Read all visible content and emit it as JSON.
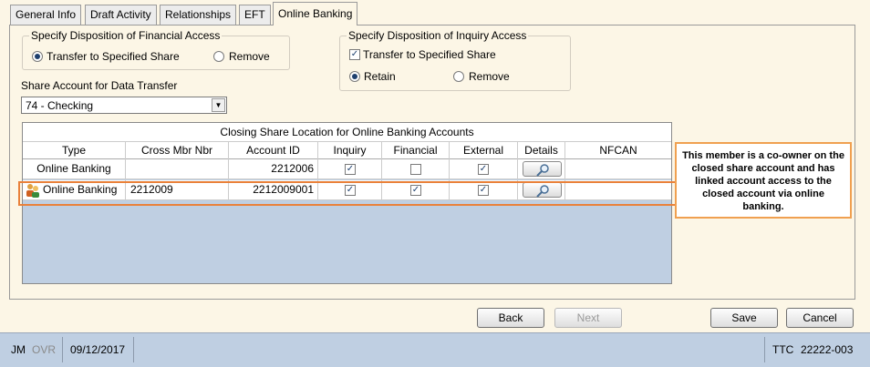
{
  "tabs": [
    "General Info",
    "Draft Activity",
    "Relationships",
    "EFT",
    "Online Banking"
  ],
  "active_tab": "Online Banking",
  "financial_access": {
    "title": "Specify Disposition of Financial Access",
    "options": [
      "Transfer to Specified Share",
      "Remove"
    ],
    "selected": "Transfer to Specified Share"
  },
  "inquiry_access": {
    "title": "Specify Disposition of Inquiry Access",
    "transfer_label": "Transfer to Specified Share",
    "transfer_checked": true,
    "options": [
      "Retain",
      "Remove"
    ],
    "selected": "Retain"
  },
  "share_account": {
    "label": "Share Account for Data Transfer",
    "value": "74 - Checking"
  },
  "grid": {
    "title": "Closing Share Location for Online Banking Accounts",
    "columns": [
      "Type",
      "Cross Mbr Nbr",
      "Account ID",
      "Inquiry",
      "Financial",
      "External",
      "Details",
      "NFCAN"
    ],
    "rows": [
      {
        "type": "Online Banking",
        "cross_mbr_nbr": "",
        "account_id": "2212006",
        "inquiry": true,
        "financial": false,
        "external": true,
        "nfcan": ""
      },
      {
        "type": "Online Banking",
        "cross_mbr_nbr": "2212009",
        "account_id": "2212009001",
        "inquiry": true,
        "financial": true,
        "external": true,
        "nfcan": ""
      }
    ]
  },
  "callout": "This member is a co-owner on the closed share account and has linked account access to the closed account via online banking.",
  "buttons": {
    "back": "Back",
    "next": "Next",
    "save": "Save",
    "cancel": "Cancel"
  },
  "status_bar": {
    "user": "JM",
    "mode": "OVR",
    "date": "09/12/2017",
    "station": "TTC",
    "session": "22222-003"
  },
  "colors": {
    "background": "#fcf6e6",
    "grid_background": "#bfcfe2",
    "highlight": "#e9813a",
    "callout_border": "#f0a050"
  }
}
